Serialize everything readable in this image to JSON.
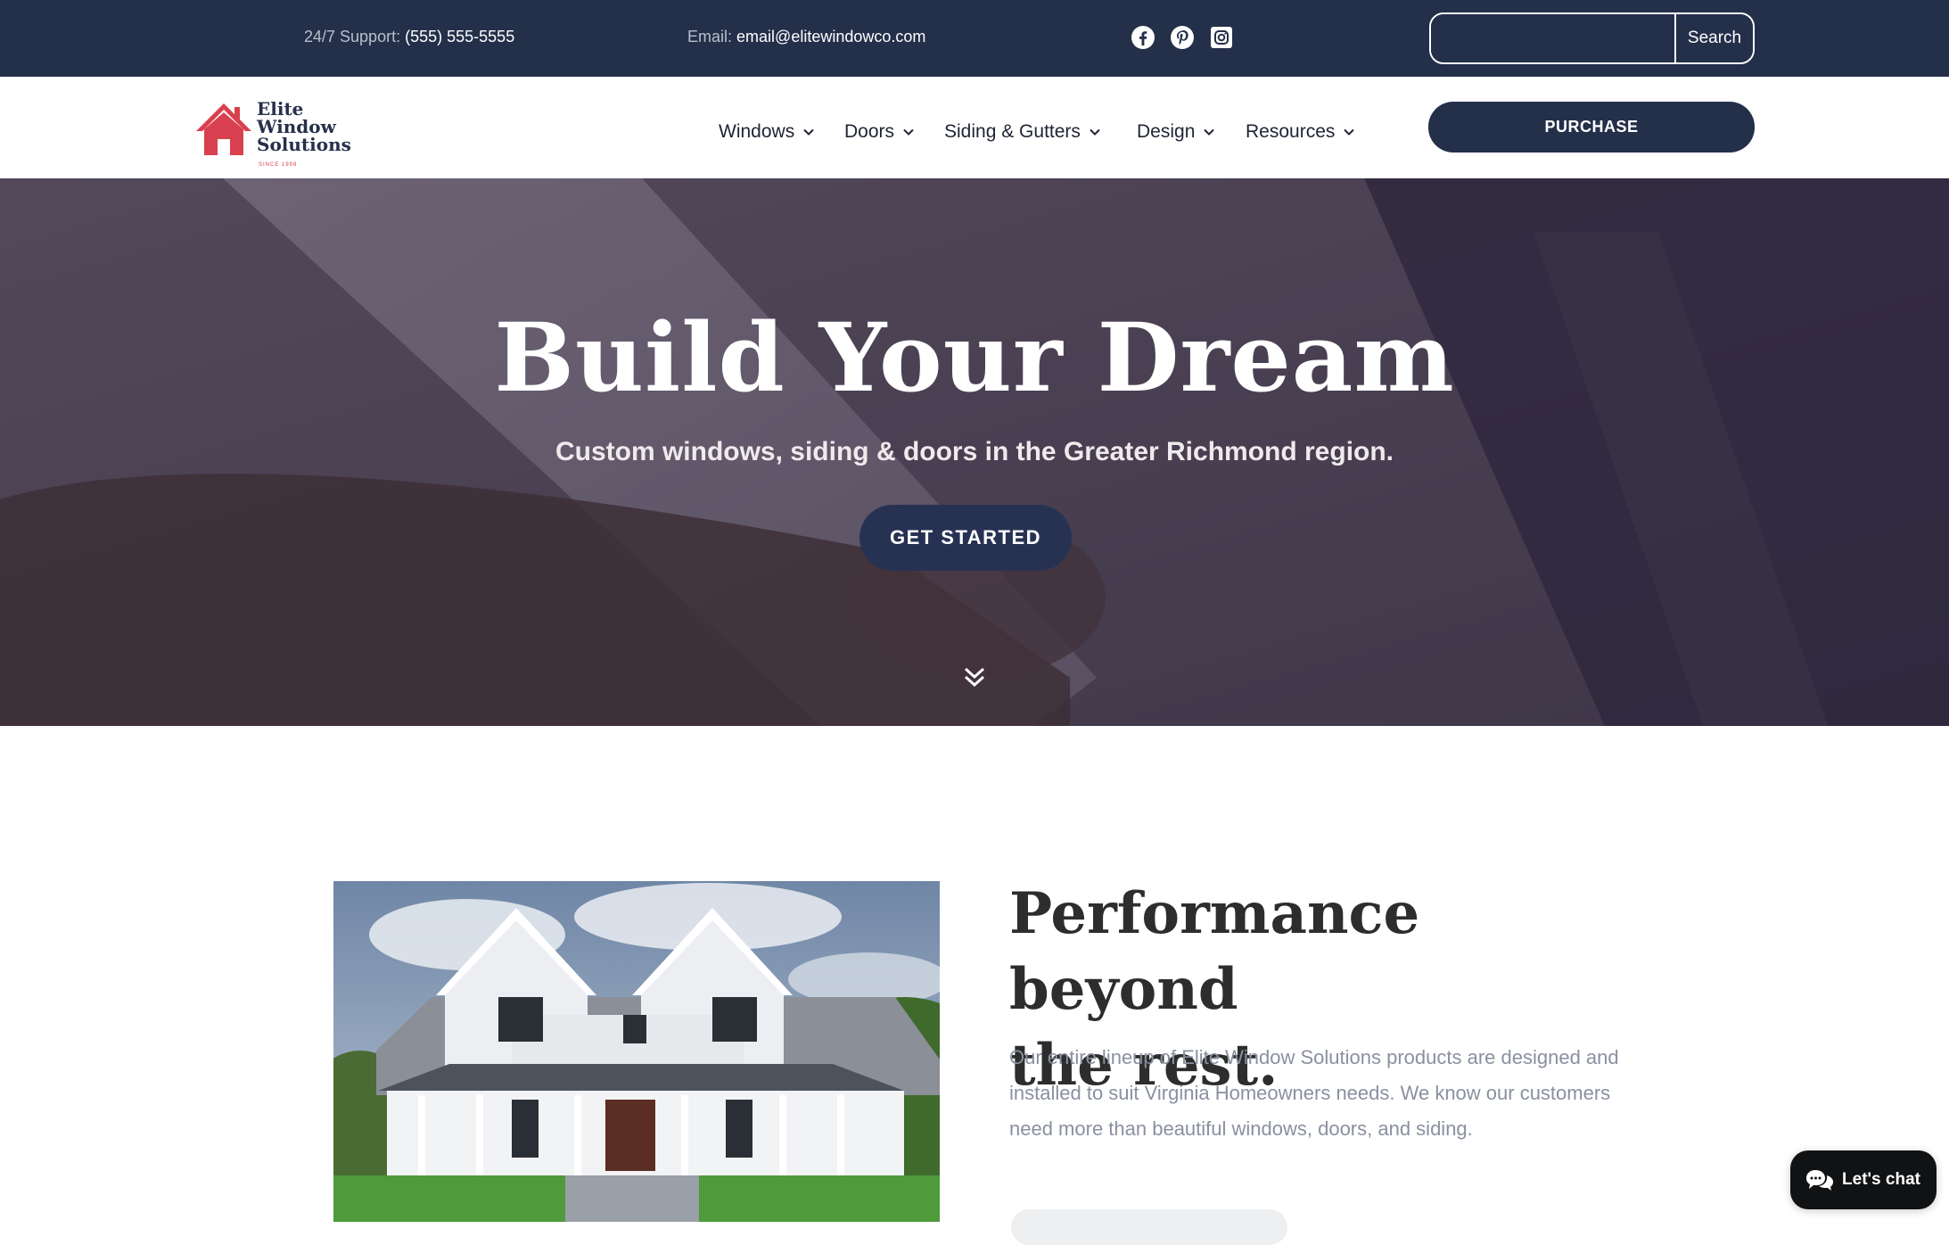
{
  "topbar": {
    "support_label": "24/7 Support:",
    "support_value": "(555) 555-5555",
    "email_label": "Email:",
    "email_value": "email@elitewindowco.com",
    "social_icons": [
      "facebook-icon",
      "pinterest-icon",
      "instagram-icon"
    ],
    "search_value": "",
    "search_button": "Search"
  },
  "nav": {
    "logo_line1": "Elite",
    "logo_line2": "Window",
    "logo_line3": "Solutions",
    "logo_since": "SINCE 1998",
    "items": [
      {
        "label": "Windows"
      },
      {
        "label": "Doors"
      },
      {
        "label": "Siding & Gutters"
      },
      {
        "label": "Design"
      },
      {
        "label": "Resources"
      }
    ],
    "purchase_label": "PURCHASE"
  },
  "hero": {
    "title": "Build Your Dream",
    "subtitle": "Custom windows, siding & doors in the Greater Richmond region.",
    "cta_label": "GET STARTED"
  },
  "section": {
    "title_line1": "Performance beyond",
    "title_line2": "the rest.",
    "body": "Our entire lineup of Elite Window Solutions products are designed and installed to suit Virginia Homeowners needs. We know our customers need more than beautiful windows, doors, and siding."
  },
  "chat": {
    "label": "Let's chat"
  },
  "colors": {
    "navy": "#242f4a",
    "brand_red": "#d9404f",
    "white": "#ffffff",
    "muted_text": "#8a90a0"
  }
}
